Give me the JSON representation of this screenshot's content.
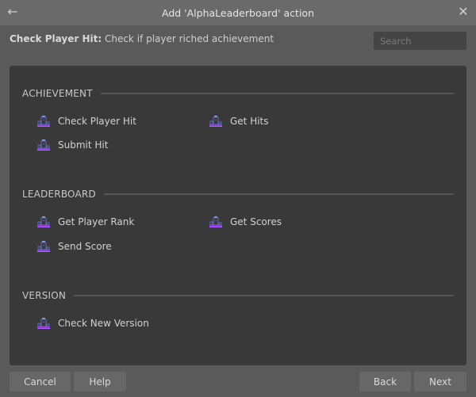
{
  "window": {
    "title": "Add 'AlphaLeaderboard' action",
    "back_icon": "arrow-left-icon",
    "close_icon": "close-icon"
  },
  "description": {
    "name": "Check Player Hit:",
    "text": " Check if player riched achievement"
  },
  "search": {
    "placeholder": "Search",
    "value": ""
  },
  "sections": [
    {
      "title": "ACHIEVEMENT",
      "items": [
        {
          "label": "Check Player Hit",
          "icon": "leaderboard-podium-icon"
        },
        {
          "label": "Get Hits",
          "icon": "leaderboard-podium-icon"
        },
        {
          "label": "Submit Hit",
          "icon": "leaderboard-podium-icon"
        }
      ]
    },
    {
      "title": "LEADERBOARD",
      "items": [
        {
          "label": "Get Player Rank",
          "icon": "leaderboard-podium-icon"
        },
        {
          "label": "Get Scores",
          "icon": "leaderboard-podium-icon"
        },
        {
          "label": "Send Score",
          "icon": "leaderboard-podium-icon"
        }
      ]
    },
    {
      "title": "VERSION",
      "items": [
        {
          "label": "Check New Version",
          "icon": "leaderboard-podium-icon"
        }
      ]
    }
  ],
  "buttons": {
    "cancel": "Cancel",
    "help": "Help",
    "back": "Back",
    "next": "Next"
  },
  "colors": {
    "icon_accent": "#8a3ee0",
    "icon_secondary": "#6a78c8"
  }
}
